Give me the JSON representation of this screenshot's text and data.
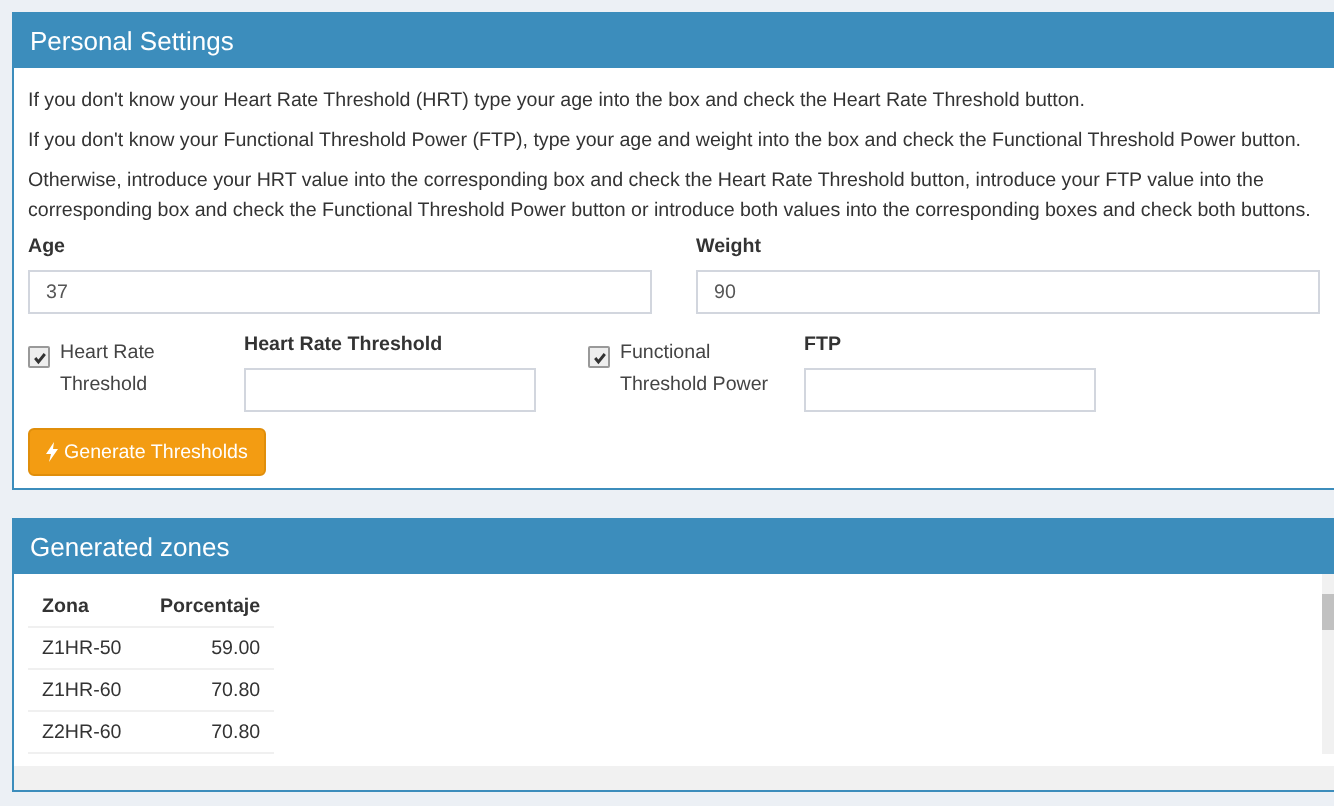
{
  "personal_settings": {
    "title": "Personal Settings",
    "paragraphs": [
      "If you don't know your Heart Rate Threshold (HRT) type your age into the box and check the Heart Rate Threshold button.",
      "If you don't know your Functional Threshold Power (FTP), type your age and weight into the box and check the Functional Threshold Power button.",
      "Otherwise, introduce your HRT value into the corresponding box and check the Heart Rate Threshold button, introduce your FTP value into the corresponding box and check the Functional Threshold Power button or introduce both values into the corresponding boxes and check both buttons."
    ],
    "fields": [
      {
        "label": "Age",
        "value": "37"
      },
      {
        "label": "Weight",
        "value": "90"
      }
    ],
    "options": [
      {
        "checkbox_label": "Heart Rate Threshold",
        "checked": true,
        "field_label": "Heart Rate Threshold"
      },
      {
        "checkbox_label": "Functional Threshold Power",
        "checked": true,
        "field_label": "FTP"
      }
    ],
    "button": "Generate Thresholds"
  },
  "generated_zones": {
    "title": "Generated zones",
    "columns": [
      "Zona",
      "Porcentaje"
    ],
    "rows": [
      [
        "Z1HR-50",
        "59.00"
      ],
      [
        "Z1HR-60",
        "70.80"
      ],
      [
        "Z2HR-60",
        "70.80"
      ]
    ]
  }
}
